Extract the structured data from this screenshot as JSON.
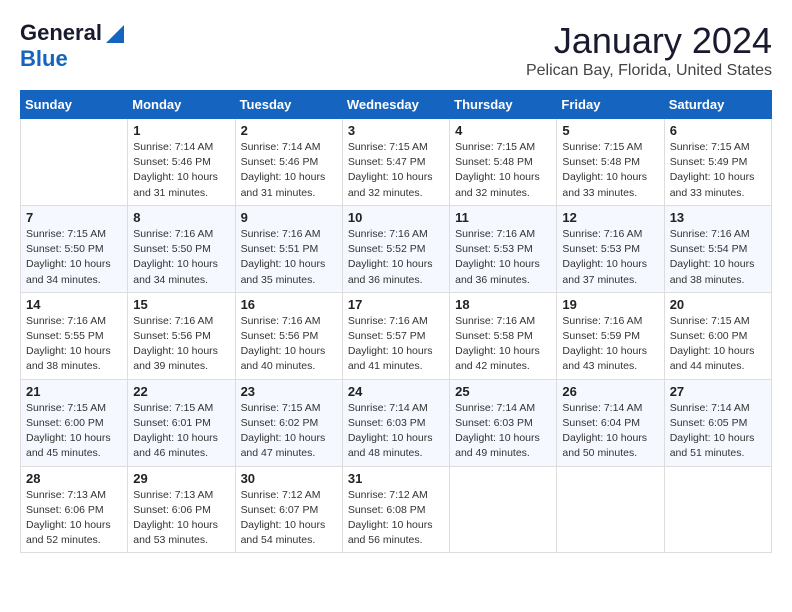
{
  "header": {
    "logo_line1": "General",
    "logo_line2": "Blue",
    "month": "January 2024",
    "location": "Pelican Bay, Florida, United States"
  },
  "days_of_week": [
    "Sunday",
    "Monday",
    "Tuesday",
    "Wednesday",
    "Thursday",
    "Friday",
    "Saturday"
  ],
  "weeks": [
    [
      {
        "num": "",
        "info": ""
      },
      {
        "num": "1",
        "info": "Sunrise: 7:14 AM\nSunset: 5:46 PM\nDaylight: 10 hours\nand 31 minutes."
      },
      {
        "num": "2",
        "info": "Sunrise: 7:14 AM\nSunset: 5:46 PM\nDaylight: 10 hours\nand 31 minutes."
      },
      {
        "num": "3",
        "info": "Sunrise: 7:15 AM\nSunset: 5:47 PM\nDaylight: 10 hours\nand 32 minutes."
      },
      {
        "num": "4",
        "info": "Sunrise: 7:15 AM\nSunset: 5:48 PM\nDaylight: 10 hours\nand 32 minutes."
      },
      {
        "num": "5",
        "info": "Sunrise: 7:15 AM\nSunset: 5:48 PM\nDaylight: 10 hours\nand 33 minutes."
      },
      {
        "num": "6",
        "info": "Sunrise: 7:15 AM\nSunset: 5:49 PM\nDaylight: 10 hours\nand 33 minutes."
      }
    ],
    [
      {
        "num": "7",
        "info": "Sunrise: 7:15 AM\nSunset: 5:50 PM\nDaylight: 10 hours\nand 34 minutes."
      },
      {
        "num": "8",
        "info": "Sunrise: 7:16 AM\nSunset: 5:50 PM\nDaylight: 10 hours\nand 34 minutes."
      },
      {
        "num": "9",
        "info": "Sunrise: 7:16 AM\nSunset: 5:51 PM\nDaylight: 10 hours\nand 35 minutes."
      },
      {
        "num": "10",
        "info": "Sunrise: 7:16 AM\nSunset: 5:52 PM\nDaylight: 10 hours\nand 36 minutes."
      },
      {
        "num": "11",
        "info": "Sunrise: 7:16 AM\nSunset: 5:53 PM\nDaylight: 10 hours\nand 36 minutes."
      },
      {
        "num": "12",
        "info": "Sunrise: 7:16 AM\nSunset: 5:53 PM\nDaylight: 10 hours\nand 37 minutes."
      },
      {
        "num": "13",
        "info": "Sunrise: 7:16 AM\nSunset: 5:54 PM\nDaylight: 10 hours\nand 38 minutes."
      }
    ],
    [
      {
        "num": "14",
        "info": "Sunrise: 7:16 AM\nSunset: 5:55 PM\nDaylight: 10 hours\nand 38 minutes."
      },
      {
        "num": "15",
        "info": "Sunrise: 7:16 AM\nSunset: 5:56 PM\nDaylight: 10 hours\nand 39 minutes."
      },
      {
        "num": "16",
        "info": "Sunrise: 7:16 AM\nSunset: 5:56 PM\nDaylight: 10 hours\nand 40 minutes."
      },
      {
        "num": "17",
        "info": "Sunrise: 7:16 AM\nSunset: 5:57 PM\nDaylight: 10 hours\nand 41 minutes."
      },
      {
        "num": "18",
        "info": "Sunrise: 7:16 AM\nSunset: 5:58 PM\nDaylight: 10 hours\nand 42 minutes."
      },
      {
        "num": "19",
        "info": "Sunrise: 7:16 AM\nSunset: 5:59 PM\nDaylight: 10 hours\nand 43 minutes."
      },
      {
        "num": "20",
        "info": "Sunrise: 7:15 AM\nSunset: 6:00 PM\nDaylight: 10 hours\nand 44 minutes."
      }
    ],
    [
      {
        "num": "21",
        "info": "Sunrise: 7:15 AM\nSunset: 6:00 PM\nDaylight: 10 hours\nand 45 minutes."
      },
      {
        "num": "22",
        "info": "Sunrise: 7:15 AM\nSunset: 6:01 PM\nDaylight: 10 hours\nand 46 minutes."
      },
      {
        "num": "23",
        "info": "Sunrise: 7:15 AM\nSunset: 6:02 PM\nDaylight: 10 hours\nand 47 minutes."
      },
      {
        "num": "24",
        "info": "Sunrise: 7:14 AM\nSunset: 6:03 PM\nDaylight: 10 hours\nand 48 minutes."
      },
      {
        "num": "25",
        "info": "Sunrise: 7:14 AM\nSunset: 6:03 PM\nDaylight: 10 hours\nand 49 minutes."
      },
      {
        "num": "26",
        "info": "Sunrise: 7:14 AM\nSunset: 6:04 PM\nDaylight: 10 hours\nand 50 minutes."
      },
      {
        "num": "27",
        "info": "Sunrise: 7:14 AM\nSunset: 6:05 PM\nDaylight: 10 hours\nand 51 minutes."
      }
    ],
    [
      {
        "num": "28",
        "info": "Sunrise: 7:13 AM\nSunset: 6:06 PM\nDaylight: 10 hours\nand 52 minutes."
      },
      {
        "num": "29",
        "info": "Sunrise: 7:13 AM\nSunset: 6:06 PM\nDaylight: 10 hours\nand 53 minutes."
      },
      {
        "num": "30",
        "info": "Sunrise: 7:12 AM\nSunset: 6:07 PM\nDaylight: 10 hours\nand 54 minutes."
      },
      {
        "num": "31",
        "info": "Sunrise: 7:12 AM\nSunset: 6:08 PM\nDaylight: 10 hours\nand 56 minutes."
      },
      {
        "num": "",
        "info": ""
      },
      {
        "num": "",
        "info": ""
      },
      {
        "num": "",
        "info": ""
      }
    ]
  ]
}
